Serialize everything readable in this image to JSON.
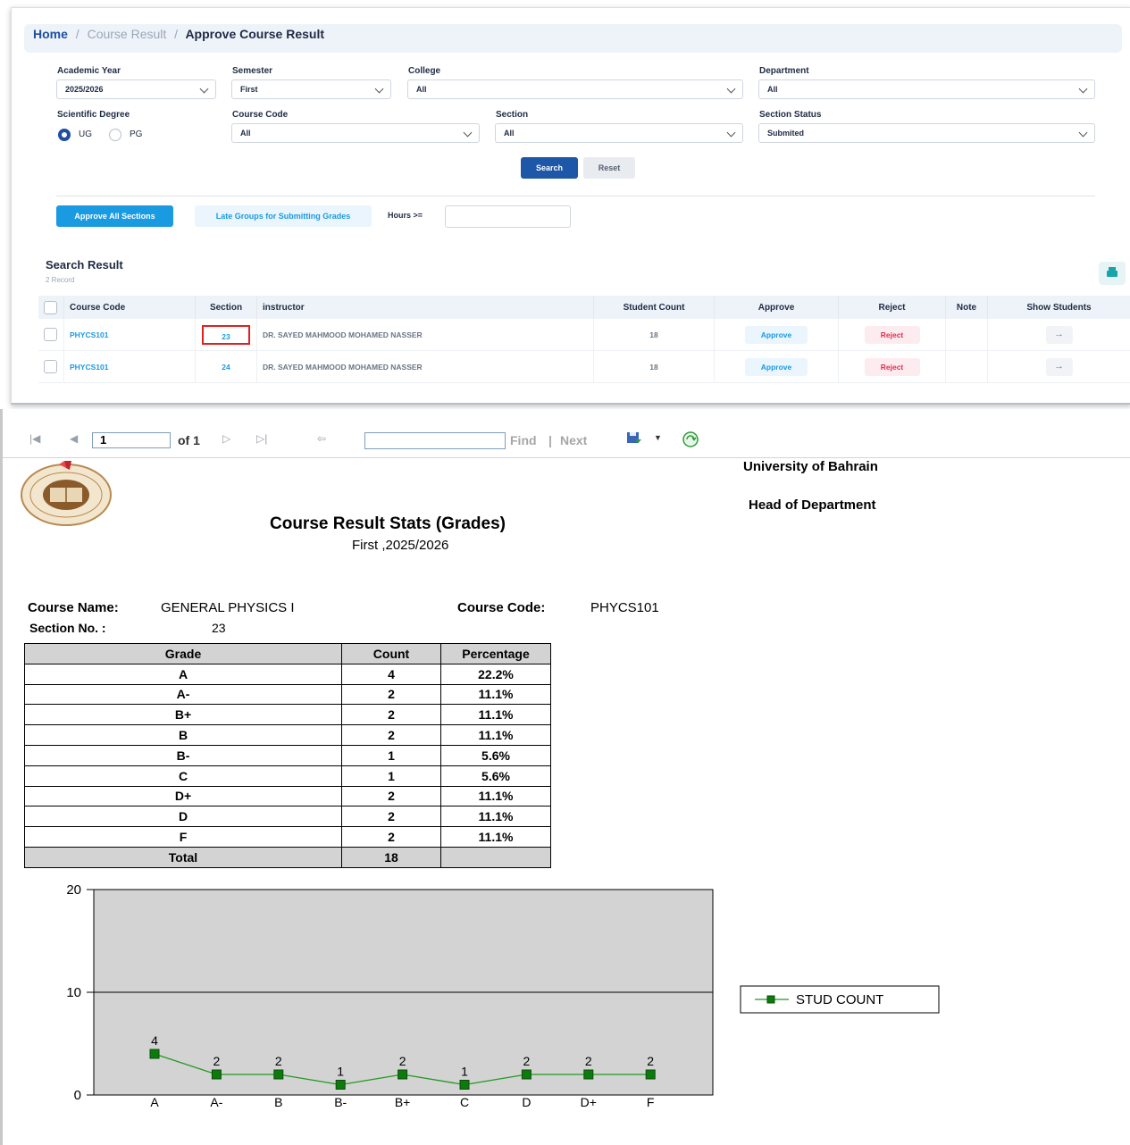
{
  "breadcrumb": {
    "home": "Home",
    "separator": "/",
    "middle": "Course Result",
    "current": "Approve Course Result"
  },
  "filters": {
    "academic_year": {
      "label": "Academic Year",
      "value": "2025/2026"
    },
    "semester": {
      "label": "Semester",
      "value": "First"
    },
    "college": {
      "label": "College",
      "value": "All"
    },
    "department": {
      "label": "Department",
      "value": "All"
    },
    "scientific_degree": {
      "label": "Scientific Degree",
      "options": [
        "UG",
        "PG"
      ],
      "selected": "UG"
    },
    "course_code": {
      "label": "Course Code",
      "value": "All"
    },
    "section": {
      "label": "Section",
      "value": "All"
    },
    "section_status": {
      "label": "Section Status",
      "value": "Submited"
    },
    "search_label": "Search",
    "reset_label": "Reset",
    "approve_all_label": "Approve All Sections",
    "late_groups_label": "Late Groups for Submitting Grades",
    "hours_label": "Hours >=",
    "hours_value": ""
  },
  "results": {
    "title": "Search Result",
    "count": "2 Record",
    "columns": [
      "Course Code",
      "Section",
      "instructor",
      "Student Count",
      "Approve",
      "Reject",
      "Note",
      "Show Students"
    ],
    "rows": [
      {
        "course_code": "PHYCS101",
        "section": "23",
        "instructor": "DR. SAYED MAHMOOD MOHAMED NASSER",
        "student_count": "18",
        "approve": "Approve",
        "reject": "Reject",
        "note": "",
        "show": "→"
      },
      {
        "course_code": "PHYCS101",
        "section": "24",
        "instructor": "DR. SAYED MAHMOOD MOHAMED NASSER",
        "student_count": "18",
        "approve": "Approve",
        "reject": "Reject",
        "note": "",
        "show": "→"
      }
    ]
  },
  "toolbar": {
    "first_icon": "first-page-icon",
    "prev_icon": "previous-page-icon",
    "next_icon": "next-page-icon",
    "last_icon": "last-page-icon",
    "back_icon": "back-icon",
    "save_icon": "export-save-icon",
    "refresh_icon": "refresh-icon",
    "page": "1",
    "of_text": "of 1",
    "find": "Find",
    "separator": "|",
    "next": "Next"
  },
  "report": {
    "university": "University of Bahrain",
    "head": "Head of Department",
    "title": "Course Result Stats (Grades)",
    "subtitle": "First ,2025/2026",
    "course_name_label": "Course Name:",
    "course_name": "GENERAL PHYSICS I",
    "course_code_label": "Course Code:",
    "course_code": "PHYCS101",
    "section_label": "Section No. :",
    "section": "23",
    "table_headers": [
      "Grade",
      "Count",
      "Percentage"
    ],
    "grades": [
      {
        "grade": "A",
        "count": "4",
        "pct": "22.2%"
      },
      {
        "grade": "A-",
        "count": "2",
        "pct": "11.1%"
      },
      {
        "grade": "B+",
        "count": "2",
        "pct": "11.1%"
      },
      {
        "grade": "B",
        "count": "2",
        "pct": "11.1%"
      },
      {
        "grade": "B-",
        "count": "1",
        "pct": "5.6%"
      },
      {
        "grade": "C",
        "count": "1",
        "pct": "5.6%"
      },
      {
        "grade": "D+",
        "count": "2",
        "pct": "11.1%"
      },
      {
        "grade": "D",
        "count": "2",
        "pct": "11.1%"
      },
      {
        "grade": "F",
        "count": "2",
        "pct": "11.1%"
      }
    ],
    "total_label": "Total",
    "total_count": "18",
    "total_pct": ""
  },
  "chart_data": {
    "type": "line",
    "categories": [
      "A",
      "A-",
      "B",
      "B-",
      "B+",
      "C",
      "D",
      "D+",
      "F"
    ],
    "series": [
      {
        "name": "STUD COUNT",
        "values": [
          4,
          2,
          2,
          1,
          2,
          1,
          2,
          2,
          2
        ],
        "color": "#1f9a1f"
      }
    ],
    "ylim": [
      0,
      20
    ],
    "yticks": [
      0,
      10,
      20
    ],
    "grid": true,
    "legend": "right",
    "plot_background": "#d3d3d3"
  },
  "colors": {
    "primary": "#1e56a8",
    "accent": "#1a9ae0",
    "reject": "#e0304e",
    "highlight": "#e02020"
  }
}
